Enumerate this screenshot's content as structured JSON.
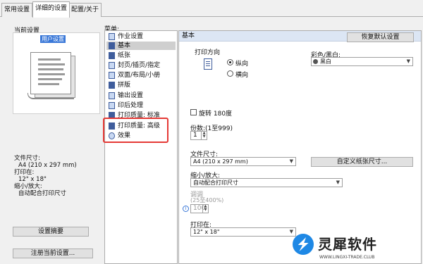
{
  "tabs": [
    {
      "label": "常用设置"
    },
    {
      "label": "详细的设置"
    },
    {
      "label": "配置/关于"
    }
  ],
  "left": {
    "current_settings_label": "当前设置",
    "preview_tag": "用户设置",
    "info": {
      "paper_size_label": "文件尺寸:",
      "paper_size_value": "A4 (210 x 297 mm)",
      "print_on_label": "打印在:",
      "print_on_value": "12\" x 18\"",
      "scale_label": "缩小/放大:",
      "scale_value": "自动配合打印尺寸"
    },
    "summary_button": "设置摘要",
    "register_button": "注册当前设置..."
  },
  "menu": {
    "label": "菜单:",
    "items": [
      {
        "label": "作业设置"
      },
      {
        "label": "基本"
      },
      {
        "label": "纸张"
      },
      {
        "label": "封页/插页/指定"
      },
      {
        "label": "双面/布局/小册"
      },
      {
        "label": "拼版"
      },
      {
        "label": "输出设置"
      },
      {
        "label": "印后处理"
      },
      {
        "label": "打印质量: 标准"
      },
      {
        "label": "打印质量: 高级"
      },
      {
        "label": "效果"
      }
    ]
  },
  "panel": {
    "title": "基本",
    "restore_button": "恢复默认设置",
    "orientation": {
      "label": "打印方向",
      "portrait": "纵向",
      "landscape": "横向",
      "selected": "纵向"
    },
    "color": {
      "label": "彩色/黑白:",
      "value": "黑白"
    },
    "rotate_label": "旋转 180度",
    "copies": {
      "label": "份数:(1至999)",
      "value": "1"
    },
    "paper_size": {
      "label": "文件尺寸:",
      "value": "A4 (210 x 297 mm)"
    },
    "custom_size_button": "自定义纸张尺寸...",
    "scale": {
      "label": "缩小/放大:",
      "value": "自动配合打印尺寸"
    },
    "zoom": {
      "label": "调调",
      "range": "(25至400%)",
      "value": "100"
    },
    "print_on": {
      "label": "打印在:",
      "value": "12\" x 18\""
    }
  },
  "brand": {
    "name": "灵犀软件",
    "url": "WWW.LINGXI-TRADE.CLUB"
  },
  "colors": {
    "highlight": "#e53935",
    "selected_tag": "#3a78d8",
    "panel_header": "#dce6f4"
  }
}
